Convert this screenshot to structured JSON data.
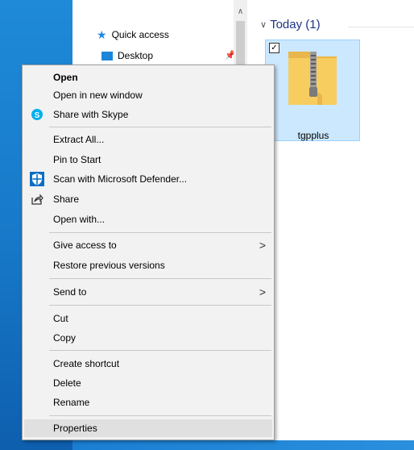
{
  "nav": {
    "quick_access": "Quick access",
    "desktop": "Desktop"
  },
  "group": {
    "title": "Today (1)"
  },
  "file": {
    "name": "tgpplus"
  },
  "menu": {
    "open": "Open",
    "open_new_window": "Open in new window",
    "share_skype": "Share with Skype",
    "extract_all": "Extract All...",
    "pin_to_start": "Pin to Start",
    "scan_defender": "Scan with Microsoft Defender...",
    "share": "Share",
    "open_with": "Open with...",
    "give_access": "Give access to",
    "restore_versions": "Restore previous versions",
    "send_to": "Send to",
    "cut": "Cut",
    "copy": "Copy",
    "create_shortcut": "Create shortcut",
    "delete": "Delete",
    "rename": "Rename",
    "properties": "Properties"
  },
  "colors": {
    "selection": "#cce8ff",
    "accent": "#0078d7",
    "menu_bg": "#f2f2f2"
  }
}
